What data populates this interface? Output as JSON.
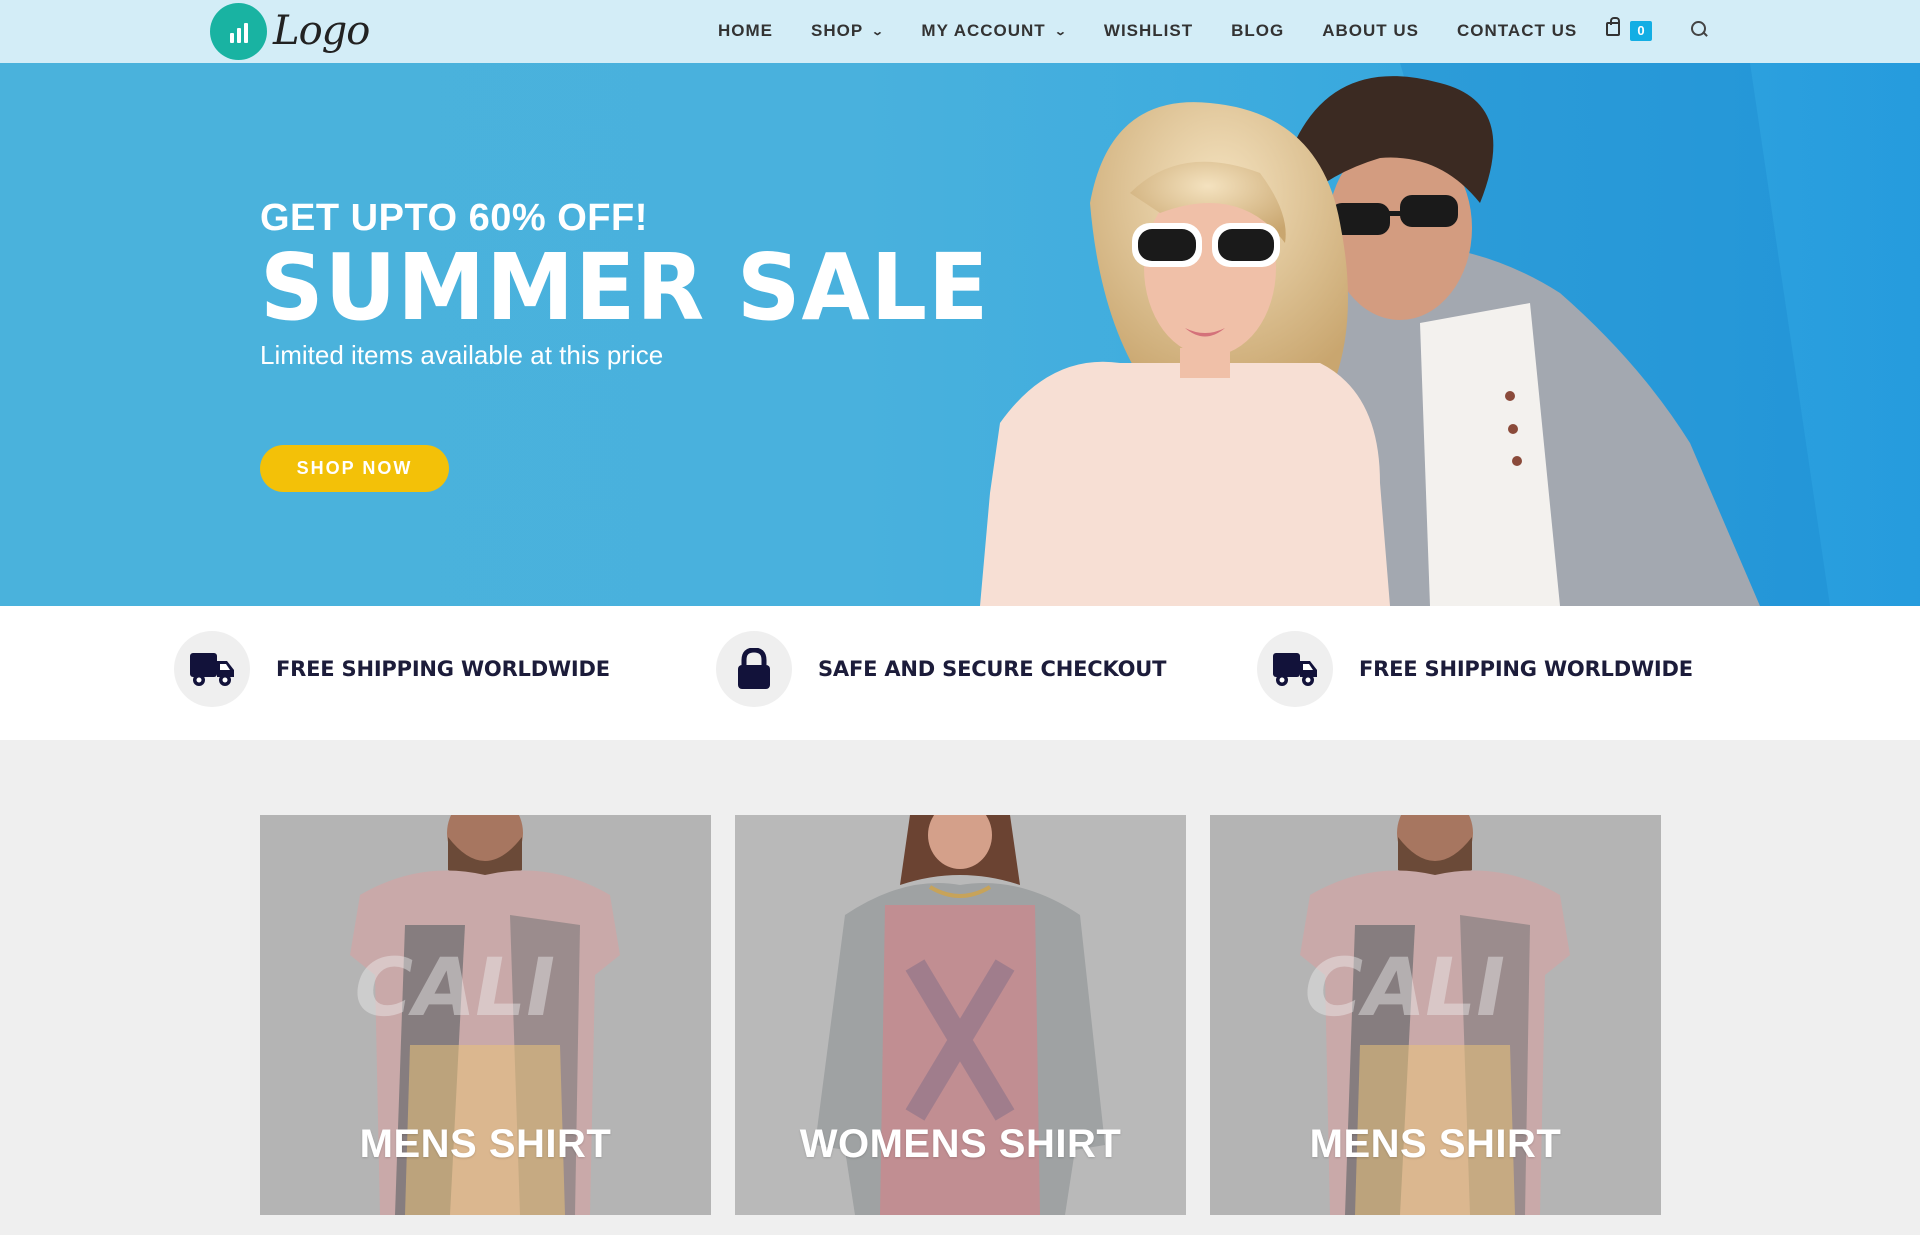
{
  "header": {
    "logo_text": "Logo",
    "nav": [
      {
        "label": "HOME",
        "has_dropdown": false
      },
      {
        "label": "SHOP",
        "has_dropdown": true
      },
      {
        "label": "MY ACCOUNT",
        "has_dropdown": true
      },
      {
        "label": "WISHLIST",
        "has_dropdown": false
      },
      {
        "label": "BLOG",
        "has_dropdown": false
      },
      {
        "label": "ABOUT US",
        "has_dropdown": false
      },
      {
        "label": "CONTACT US",
        "has_dropdown": false
      }
    ],
    "cart_count": "0",
    "icons": [
      "chart-logo-icon",
      "shopping-bag-icon",
      "search-icon"
    ]
  },
  "hero": {
    "kicker": "GET UPTO 60% OFF!",
    "title": "SUMMER SALE",
    "subtitle": "Limited items available at this price",
    "button_label": "SHOP NOW"
  },
  "features": [
    {
      "label": "FREE SHIPPING WORLDWIDE",
      "icon": "truck-icon"
    },
    {
      "label": "SAFE AND SECURE CHECKOUT",
      "icon": "lock-icon"
    },
    {
      "label": "FREE SHIPPING WORLDWIDE",
      "icon": "truck-icon"
    }
  ],
  "categories": [
    {
      "label": "MENS SHIRT"
    },
    {
      "label": "WOMENS SHIRT"
    },
    {
      "label": "MENS SHIRT"
    }
  ],
  "colors": {
    "header_bg": "#d3edf7",
    "hero_bg": "#4ab2dc",
    "accent_yellow": "#f3c108",
    "cart_badge": "#13aee4",
    "logo_teal": "#19b3a2",
    "feature_text": "#1c1c3a"
  }
}
